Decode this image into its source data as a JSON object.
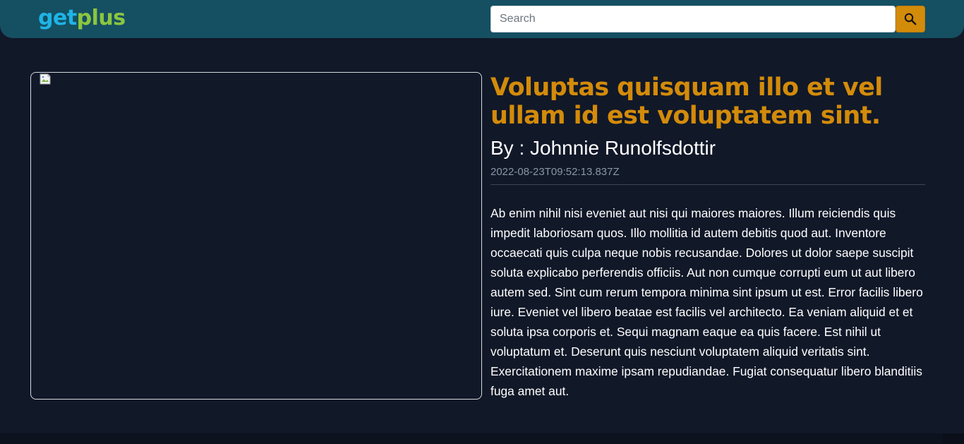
{
  "header": {
    "logo": {
      "part1": "get",
      "part2": "plus"
    },
    "search": {
      "placeholder": "Search",
      "value": ""
    },
    "search_icon": "search-icon",
    "colors": {
      "nav_bg": "#154f62",
      "accent": "#d38b0a"
    }
  },
  "article": {
    "image_state": "broken-image-icon",
    "title": "Voluptas quisquam illo et vel ullam id est voluptatem sint.",
    "author": "By : Johnnie Runolfsdottir",
    "date": "2022-08-23T09:52:13.837Z",
    "body": "Ab enim nihil nisi eveniet aut nisi qui maiores maiores. Illum reiciendis quis impedit laboriosam quos. Illo mollitia id autem debitis quod aut. Inventore occaecati quis culpa neque nobis recusandae. Dolores ut dolor saepe suscipit soluta explicabo perferendis officiis. Aut non cumque corrupti eum ut aut libero autem sed. Sint cum rerum tempora minima sint ipsum ut est. Error facilis libero iure. Eveniet vel libero beatae est facilis vel architecto. Ea veniam aliquid et et soluta ipsa corporis et. Sequi magnam eaque ea quis facere. Est nihil ut voluptatum et. Deserunt quis nesciunt voluptatem aliquid veritatis sint. Exercitationem maxime ipsam repudiandae. Fugiat consequatur libero blanditiis fuga amet aut."
  }
}
